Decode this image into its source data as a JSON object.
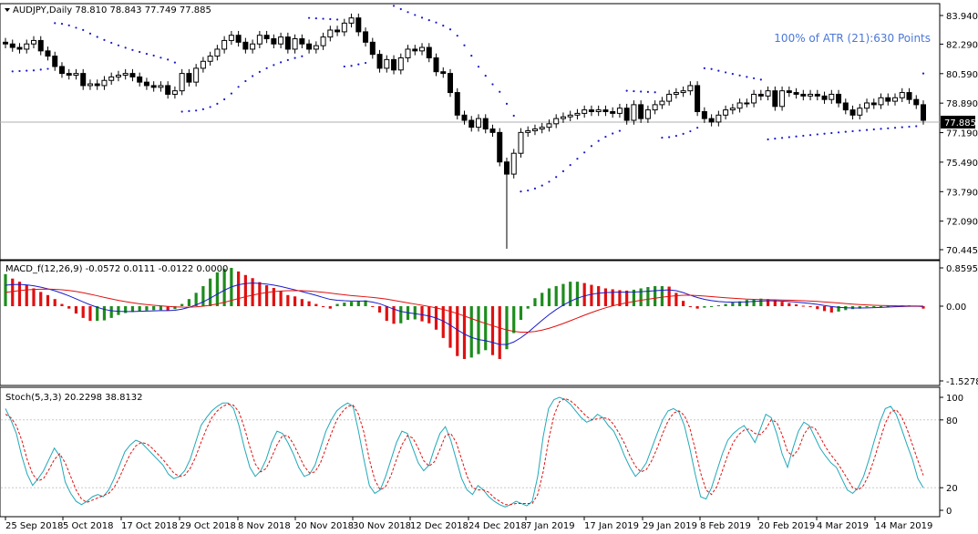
{
  "header": {
    "symbol_line": "AUDJPY,Daily  78.810 78.843 77.749 77.885",
    "atr_text": "100% of ATR (21):630 Points"
  },
  "main_panel": {
    "price_ticks": [
      "83.940",
      "82.290",
      "80.590",
      "78.890",
      "77.190",
      "75.490",
      "73.790",
      "72.090",
      "70.445"
    ],
    "current_price_label": "77.885"
  },
  "macd_panel": {
    "title": "MACD_f(12,26,9) -0.0572 0.0111 -0.0122 0.0000",
    "ticks": [
      "0.8595",
      "0.00",
      "-1.5278"
    ]
  },
  "stoch_panel": {
    "title": "Stoch(5,3,3) 20.2298 38.8132",
    "ticks": [
      "100",
      "80",
      "20",
      "0"
    ]
  },
  "date_labels": [
    "25 Sep 2018",
    "5 Oct 2018",
    "17 Oct 2018",
    "29 Oct 2018",
    "8 Nov 2018",
    "20 Nov 2018",
    "30 Nov 2018",
    "12 Dec 2018",
    "24 Dec 2018",
    "7 Jan 2019",
    "17 Jan 2019",
    "29 Jan 2019",
    "8 Feb 2019",
    "20 Feb 2019",
    "4 Mar 2019",
    "14 Mar 2019"
  ],
  "colors": {
    "candle": "#000000",
    "sar_dots": "#1a1acc",
    "macd_pos": "#1e8c1e",
    "macd_neg": "#e01010",
    "macd_main": "#1a1acc",
    "macd_signal": "#e01010",
    "stoch_main": "#20a8b8",
    "stoch_signal": "#e01010",
    "atr_text": "#4a78d8"
  },
  "chart_data": [
    {
      "type": "candlestick",
      "title": "AUDJPY,Daily",
      "ylim": [
        70.0,
        84.5
      ],
      "close": [
        82.3,
        82.1,
        82.0,
        82.3,
        82.5,
        81.9,
        81.6,
        81.0,
        80.6,
        80.5,
        80.6,
        79.9,
        80.0,
        79.9,
        80.2,
        80.4,
        80.5,
        80.6,
        80.4,
        80.1,
        79.9,
        79.8,
        79.9,
        79.4,
        79.6,
        80.6,
        80.1,
        80.9,
        81.3,
        81.6,
        82.0,
        82.5,
        82.8,
        82.4,
        82.0,
        82.3,
        82.8,
        82.6,
        82.3,
        82.7,
        82.0,
        82.6,
        82.3,
        82.0,
        82.2,
        82.7,
        83.1,
        83.0,
        83.5,
        83.8,
        83.0,
        82.4,
        81.7,
        80.9,
        81.4,
        80.8,
        81.5,
        82.0,
        81.9,
        82.1,
        81.5,
        80.7,
        80.6,
        79.5,
        78.2,
        77.9,
        77.5,
        78.0,
        77.4,
        77.2,
        75.5,
        74.8,
        76.0,
        77.2,
        77.3,
        77.4,
        77.5,
        77.7,
        78.0,
        78.1,
        78.2,
        78.3,
        78.5,
        78.4,
        78.5,
        78.4,
        78.3,
        78.6,
        77.9,
        78.8,
        78.0,
        78.5,
        78.8,
        79.0,
        79.4,
        79.5,
        79.6,
        79.9,
        78.4,
        78.0,
        77.8,
        78.2,
        78.5,
        78.6,
        78.9,
        78.9,
        79.4,
        79.3,
        79.6,
        78.7,
        79.6,
        79.5,
        79.4,
        79.3,
        79.4,
        79.3,
        79.1,
        79.4,
        78.9,
        78.5,
        78.2,
        78.6,
        78.9,
        78.8,
        79.2,
        79.0,
        79.2,
        79.5,
        79.1,
        78.8,
        77.9
      ]
    },
    {
      "type": "bar",
      "name": "MACD",
      "ylim": [
        -1.5278,
        0.8595
      ],
      "values": [
        0.72,
        0.62,
        0.55,
        0.48,
        0.4,
        0.32,
        0.25,
        0.16,
        0.05,
        -0.05,
        -0.15,
        -0.24,
        -0.3,
        -0.3,
        -0.29,
        -0.24,
        -0.18,
        -0.14,
        -0.12,
        -0.1,
        -0.09,
        -0.08,
        -0.08,
        -0.09,
        -0.06,
        0.05,
        0.16,
        0.3,
        0.45,
        0.62,
        0.76,
        0.84,
        0.86,
        0.78,
        0.7,
        0.63,
        0.54,
        0.47,
        0.41,
        0.34,
        0.25,
        0.22,
        0.16,
        0.11,
        0.05,
        -0.02,
        -0.05,
        0.05,
        0.08,
        0.1,
        0.12,
        0.13,
        -0.01,
        -0.13,
        -0.3,
        -0.36,
        -0.35,
        -0.28,
        -0.27,
        -0.31,
        -0.35,
        -0.48,
        -0.65,
        -0.85,
        -1.02,
        -1.08,
        -1.05,
        -0.98,
        -0.9,
        -1.0,
        -1.08,
        -0.88,
        -0.55,
        -0.28,
        -0.05,
        0.18,
        0.3,
        0.4,
        0.45,
        0.5,
        0.55,
        0.55,
        0.52,
        0.48,
        0.45,
        0.4,
        0.38,
        0.36,
        0.35,
        0.37,
        0.4,
        0.43,
        0.45,
        0.45,
        0.44,
        0.3,
        0.12,
        -0.02,
        -0.05,
        -0.03,
        -0.01,
        0.02,
        0.05,
        0.08,
        0.11,
        0.14,
        0.16,
        0.17,
        0.16,
        0.13,
        0.1,
        0.07,
        0.04,
        0.01,
        -0.02,
        -0.06,
        -0.1,
        -0.13,
        -0.11,
        -0.08,
        -0.06,
        -0.05,
        -0.02,
        -0.01,
        0.0,
        0.01,
        0.02,
        0.02,
        0.02,
        0.01,
        -0.05
      ]
    },
    {
      "type": "line",
      "name": "Stoch",
      "ylim": [
        0,
        100
      ],
      "yticks": [
        0,
        20,
        80,
        100
      ],
      "series": [
        {
          "values": [
            90,
            80,
            68,
            48,
            32,
            22,
            28,
            35,
            45,
            55,
            48,
            25,
            15,
            8,
            5,
            8,
            12,
            14,
            12,
            18,
            28,
            40,
            52,
            58,
            62,
            60,
            55,
            50,
            45,
            40,
            32,
            28,
            30,
            35,
            45,
            60,
            75,
            82,
            88,
            92,
            95,
            95,
            90,
            75,
            55,
            38,
            30,
            35,
            45,
            60,
            70,
            68,
            60,
            50,
            38,
            30,
            32,
            40,
            55,
            70,
            80,
            88,
            92,
            95,
            92,
            70,
            45,
            22,
            15,
            18,
            30,
            45,
            60,
            70,
            68,
            55,
            42,
            35,
            40,
            55,
            68,
            74,
            62,
            45,
            28,
            18,
            14,
            22,
            18,
            12,
            8,
            5,
            3,
            5,
            8,
            6,
            4,
            8,
            30,
            65,
            90,
            98,
            100,
            98,
            94,
            88,
            82,
            78,
            80,
            85,
            82,
            75,
            70,
            60,
            48,
            38,
            30,
            35,
            42,
            55,
            68,
            80,
            88,
            90,
            87,
            75,
            55,
            32,
            12,
            10,
            20,
            35,
            50,
            62,
            68,
            72,
            75,
            68,
            60,
            72,
            85,
            82,
            68,
            50,
            38,
            55,
            70,
            78,
            75,
            65,
            55,
            48,
            42,
            38,
            28,
            18,
            15,
            20,
            30,
            45,
            62,
            78,
            90,
            92,
            85,
            72,
            58,
            45,
            28,
            20
          ]
        },
        {
          "values": [
            85,
            82,
            75,
            62,
            45,
            32,
            26,
            28,
            36,
            45,
            50,
            42,
            30,
            18,
            10,
            7,
            9,
            11,
            13,
            15,
            20,
            29,
            40,
            50,
            57,
            60,
            59,
            55,
            50,
            45,
            39,
            33,
            30,
            31,
            37,
            47,
            60,
            72,
            82,
            88,
            92,
            94,
            93,
            87,
            73,
            56,
            41,
            34,
            37,
            47,
            58,
            66,
            66,
            59,
            49,
            39,
            33,
            34,
            42,
            55,
            68,
            80,
            87,
            92,
            93,
            85,
            69,
            45,
            27,
            18,
            21,
            31,
            45,
            58,
            66,
            64,
            55,
            44,
            39,
            43,
            54,
            66,
            68,
            60,
            45,
            30,
            20,
            18,
            18,
            16,
            11,
            8,
            5,
            5,
            6,
            6,
            6,
            6,
            14,
            34,
            62,
            84,
            96,
            99,
            97,
            93,
            88,
            83,
            80,
            81,
            82,
            81,
            76,
            68,
            59,
            48,
            39,
            34,
            36,
            44,
            55,
            68,
            79,
            86,
            88,
            84,
            73,
            54,
            33,
            18,
            14,
            21,
            35,
            49,
            60,
            67,
            71,
            72,
            68,
            67,
            72,
            80,
            78,
            67,
            52,
            48,
            54,
            67,
            74,
            73,
            65,
            56,
            49,
            43,
            36,
            28,
            20,
            18,
            22,
            32,
            46,
            62,
            77,
            87,
            89,
            83,
            72,
            58,
            44,
            31
          ]
        }
      ]
    }
  ]
}
